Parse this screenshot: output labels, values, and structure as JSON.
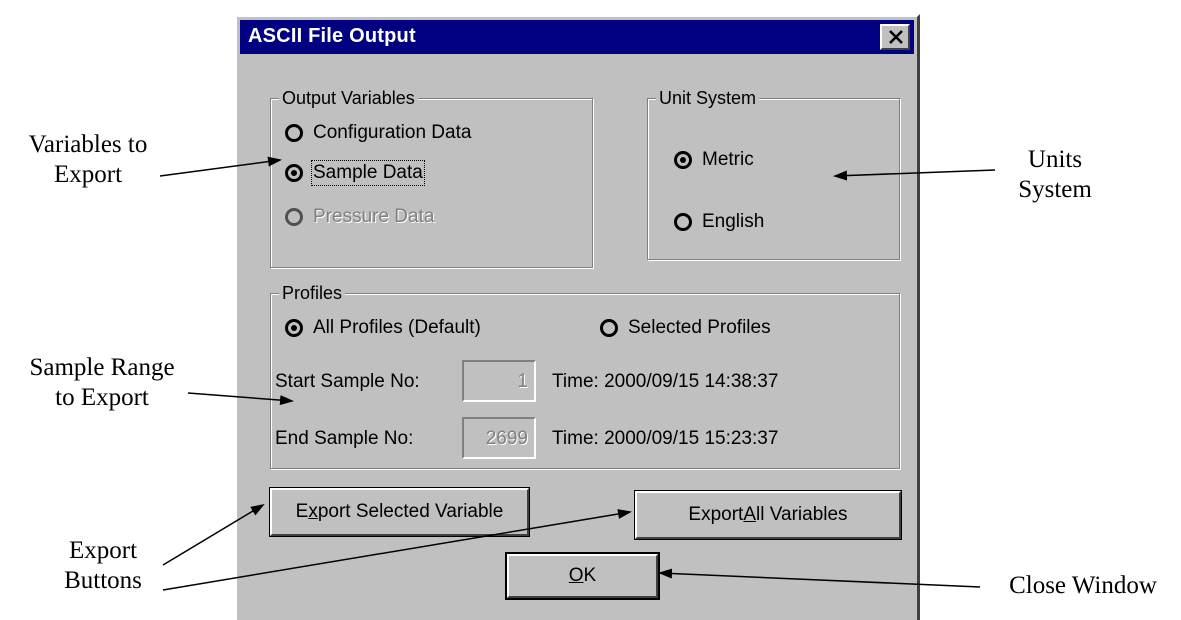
{
  "window": {
    "title": "ASCII File Output"
  },
  "output_variables": {
    "legend": "Output Variables",
    "options": [
      {
        "label": "Configuration Data",
        "selected": false,
        "enabled": true
      },
      {
        "label": "Sample Data",
        "selected": true,
        "enabled": true
      },
      {
        "label": "Pressure Data",
        "selected": false,
        "enabled": false
      }
    ]
  },
  "unit_system": {
    "legend": "Unit System",
    "options": [
      {
        "label": "Metric",
        "selected": true
      },
      {
        "label": "English",
        "selected": false
      }
    ]
  },
  "profiles": {
    "legend": "Profiles",
    "all_label": "All Profiles (Default)",
    "selected_label": "Selected Profiles",
    "start_label": "Start Sample No:",
    "start_value": "1",
    "start_time": "Time: 2000/09/15  14:38:37",
    "end_label": "End Sample No:",
    "end_value": "2699",
    "end_time": "Time: 2000/09/15  15:23:37"
  },
  "buttons": {
    "export_selected": {
      "pre": "E",
      "key": "x",
      "post": "port Selected Variable"
    },
    "export_all": {
      "pre": "Export ",
      "key": "A",
      "post": "ll Variables"
    },
    "ok": {
      "pre": "",
      "key": "O",
      "post": "K"
    }
  },
  "annotations": {
    "variables_line1": "Variables to",
    "variables_line2": "Export",
    "units_line1": "Units",
    "units_line2": "System",
    "range_line1": "Sample Range",
    "range_line2": "to Export",
    "export_line1": "Export",
    "export_line2": "Buttons",
    "close": "Close Window"
  }
}
